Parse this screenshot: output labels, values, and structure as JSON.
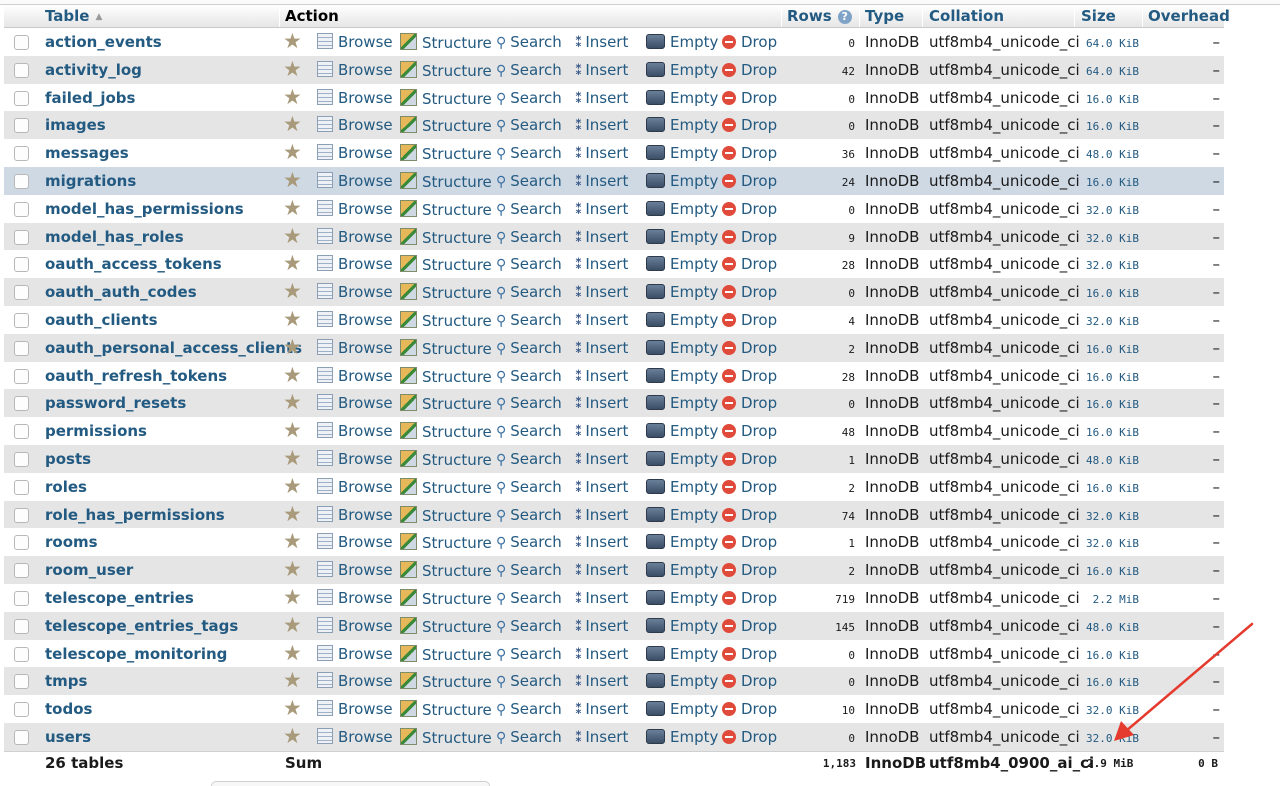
{
  "header": {
    "table": "Table",
    "action": "Action",
    "rows": "Rows",
    "type": "Type",
    "collation": "Collation",
    "size": "Size",
    "overhead": "Overhead"
  },
  "actions": {
    "browse": "Browse",
    "structure": "Structure",
    "search": "Search",
    "insert": "Insert",
    "empty": "Empty",
    "drop": "Drop"
  },
  "tables": [
    {
      "name": "action_events",
      "rows": "0",
      "type": "InnoDB",
      "collation": "utf8mb4_unicode_ci",
      "size": "64.0 KiB",
      "overhead": "–"
    },
    {
      "name": "activity_log",
      "rows": "42",
      "type": "InnoDB",
      "collation": "utf8mb4_unicode_ci",
      "size": "64.0 KiB",
      "overhead": "–"
    },
    {
      "name": "failed_jobs",
      "rows": "0",
      "type": "InnoDB",
      "collation": "utf8mb4_unicode_ci",
      "size": "16.0 KiB",
      "overhead": "–"
    },
    {
      "name": "images",
      "rows": "0",
      "type": "InnoDB",
      "collation": "utf8mb4_unicode_ci",
      "size": "16.0 KiB",
      "overhead": "–"
    },
    {
      "name": "messages",
      "rows": "36",
      "type": "InnoDB",
      "collation": "utf8mb4_unicode_ci",
      "size": "48.0 KiB",
      "overhead": "–"
    },
    {
      "name": "migrations",
      "rows": "24",
      "type": "InnoDB",
      "collation": "utf8mb4_unicode_ci",
      "size": "16.0 KiB",
      "overhead": "–"
    },
    {
      "name": "model_has_permissions",
      "rows": "0",
      "type": "InnoDB",
      "collation": "utf8mb4_unicode_ci",
      "size": "32.0 KiB",
      "overhead": "–"
    },
    {
      "name": "model_has_roles",
      "rows": "9",
      "type": "InnoDB",
      "collation": "utf8mb4_unicode_ci",
      "size": "32.0 KiB",
      "overhead": "–"
    },
    {
      "name": "oauth_access_tokens",
      "rows": "28",
      "type": "InnoDB",
      "collation": "utf8mb4_unicode_ci",
      "size": "32.0 KiB",
      "overhead": "–"
    },
    {
      "name": "oauth_auth_codes",
      "rows": "0",
      "type": "InnoDB",
      "collation": "utf8mb4_unicode_ci",
      "size": "16.0 KiB",
      "overhead": "–"
    },
    {
      "name": "oauth_clients",
      "rows": "4",
      "type": "InnoDB",
      "collation": "utf8mb4_unicode_ci",
      "size": "32.0 KiB",
      "overhead": "–"
    },
    {
      "name": "oauth_personal_access_clients",
      "rows": "2",
      "type": "InnoDB",
      "collation": "utf8mb4_unicode_ci",
      "size": "16.0 KiB",
      "overhead": "–"
    },
    {
      "name": "oauth_refresh_tokens",
      "rows": "28",
      "type": "InnoDB",
      "collation": "utf8mb4_unicode_ci",
      "size": "16.0 KiB",
      "overhead": "–"
    },
    {
      "name": "password_resets",
      "rows": "0",
      "type": "InnoDB",
      "collation": "utf8mb4_unicode_ci",
      "size": "16.0 KiB",
      "overhead": "–"
    },
    {
      "name": "permissions",
      "rows": "48",
      "type": "InnoDB",
      "collation": "utf8mb4_unicode_ci",
      "size": "16.0 KiB",
      "overhead": "–"
    },
    {
      "name": "posts",
      "rows": "1",
      "type": "InnoDB",
      "collation": "utf8mb4_unicode_ci",
      "size": "48.0 KiB",
      "overhead": "–"
    },
    {
      "name": "roles",
      "rows": "2",
      "type": "InnoDB",
      "collation": "utf8mb4_unicode_ci",
      "size": "16.0 KiB",
      "overhead": "–"
    },
    {
      "name": "role_has_permissions",
      "rows": "74",
      "type": "InnoDB",
      "collation": "utf8mb4_unicode_ci",
      "size": "32.0 KiB",
      "overhead": "–"
    },
    {
      "name": "rooms",
      "rows": "1",
      "type": "InnoDB",
      "collation": "utf8mb4_unicode_ci",
      "size": "32.0 KiB",
      "overhead": "–"
    },
    {
      "name": "room_user",
      "rows": "2",
      "type": "InnoDB",
      "collation": "utf8mb4_unicode_ci",
      "size": "16.0 KiB",
      "overhead": "–"
    },
    {
      "name": "telescope_entries",
      "rows": "719",
      "type": "InnoDB",
      "collation": "utf8mb4_unicode_ci",
      "size": "2.2 MiB",
      "overhead": "–"
    },
    {
      "name": "telescope_entries_tags",
      "rows": "145",
      "type": "InnoDB",
      "collation": "utf8mb4_unicode_ci",
      "size": "48.0 KiB",
      "overhead": "–"
    },
    {
      "name": "telescope_monitoring",
      "rows": "0",
      "type": "InnoDB",
      "collation": "utf8mb4_unicode_ci",
      "size": "16.0 KiB",
      "overhead": "–"
    },
    {
      "name": "tmps",
      "rows": "0",
      "type": "InnoDB",
      "collation": "utf8mb4_unicode_ci",
      "size": "16.0 KiB",
      "overhead": "–"
    },
    {
      "name": "todos",
      "rows": "10",
      "type": "InnoDB",
      "collation": "utf8mb4_unicode_ci",
      "size": "32.0 KiB",
      "overhead": "–"
    },
    {
      "name": "users",
      "rows": "0",
      "type": "InnoDB",
      "collation": "utf8mb4_unicode_ci",
      "size": "32.0 KiB",
      "overhead": "–"
    }
  ],
  "footer": {
    "count": "26 tables",
    "sum_label": "Sum",
    "rows": "1,183",
    "type": "InnoDB",
    "collation": "utf8mb4_0900_ai_ci",
    "size": "2.9 MiB",
    "overhead": "0 B"
  },
  "colors": {
    "link": "#235a81",
    "row_alt": "#e5e5e5",
    "row_highlight": "#cfd9e4",
    "annotation_arrow": "#e53a2e"
  }
}
